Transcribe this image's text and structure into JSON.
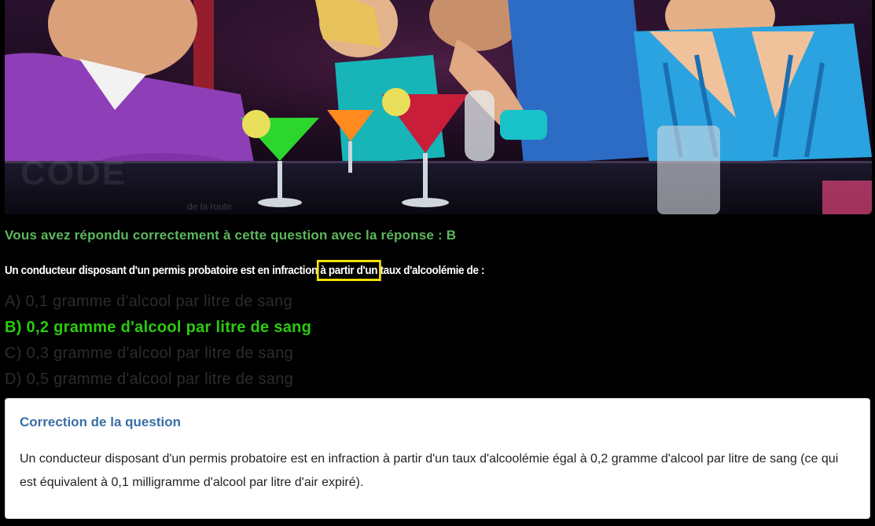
{
  "hero": {
    "image": "bar-cocktails-photo",
    "watermark": "CODE",
    "watermark_sub": "de la route"
  },
  "result": {
    "text": "Vous avez répondu correctement à cette question avec la réponse : B",
    "color": "#5cb85c"
  },
  "question": {
    "before": "Un conducteur disposant d'un permis probatoire est en infraction ",
    "highlighted": "à partir d'un",
    "after": " taux d'alcoolémie de :",
    "highlight_color": "#f5e100"
  },
  "answers": [
    {
      "label": "A) 0,1 gramme d'alcool par litre de sang",
      "correct": false
    },
    {
      "label": "B) 0,2 gramme d'alcool par litre de sang",
      "correct": true
    },
    {
      "label": "C) 0,3 gramme d'alcool par litre de sang",
      "correct": false
    },
    {
      "label": "D) 0,5 gramme d'alcool par litre de sang",
      "correct": false
    }
  ],
  "correction": {
    "title": "Correction de la question",
    "body": "Un conducteur disposant d'un permis probatoire est en infraction à partir d'un taux d'alcoolémie égal à 0,2 gramme d'alcool par litre de sang (ce qui est équivalent à 0,1 milligramme d'alcool par litre d'air expiré).",
    "title_color": "#3a6ea5"
  },
  "colors": {
    "correct_answer": "#2bcc0d",
    "wrong_answer": "#2c2c2c",
    "background": "#000000"
  }
}
